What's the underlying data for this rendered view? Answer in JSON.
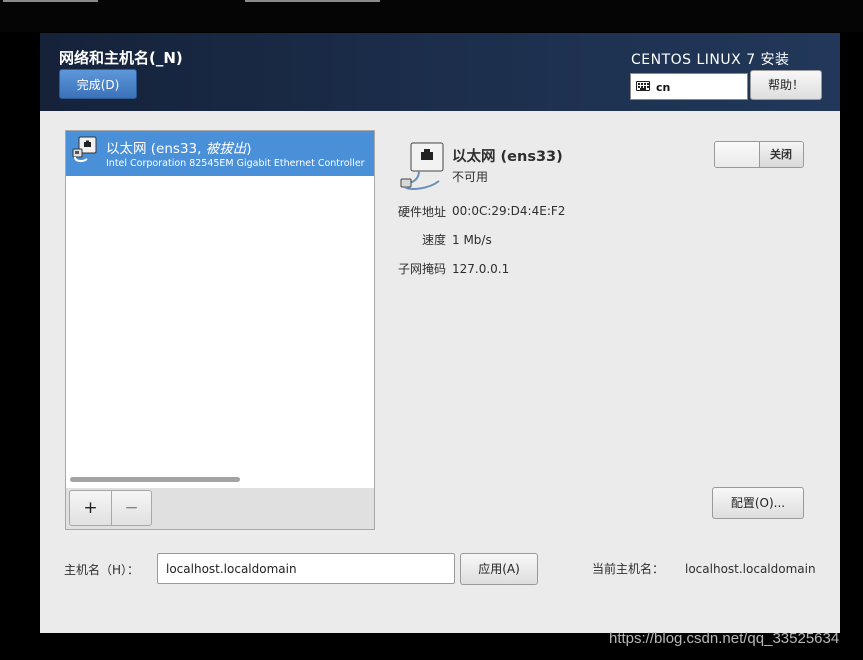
{
  "window": {
    "title": "网络和主机名(_N)",
    "done_label": "完成(D)",
    "product_title": "CENTOS LINUX 7 安装",
    "keyboard_layout": "cn",
    "help_label": "帮助！"
  },
  "device_list": {
    "items": [
      {
        "name": "以太网 (ens33, ",
        "name_state": "被拔出",
        "name_close": ")",
        "description": "Intel Corporation 82545EM Gigabit Ethernet Controller",
        "selected": true
      }
    ],
    "add_label": "+",
    "remove_label": "−"
  },
  "device_detail": {
    "name": "以太网 (ens33)",
    "status": "不可用",
    "toggle_label": "关闭",
    "properties": [
      {
        "label": "硬件地址",
        "value": "00:0C:29:D4:4E:F2"
      },
      {
        "label": "速度",
        "value": "1 Mb/s"
      },
      {
        "label": "子网掩码",
        "value": "127.0.0.1"
      }
    ],
    "configure_label": "配置(O)..."
  },
  "hostname": {
    "label": "主机名（H）：",
    "value": "localhost.localdomain",
    "apply_label": "应用(A)",
    "current_label": "当前主机名：",
    "current_value": "localhost.localdomain"
  },
  "watermark": "https://blog.csdn.net/qq_33525634",
  "colors": {
    "header_bg": "#1c2f4d",
    "accent_blue": "#4a90d9",
    "window_bg": "#ebebeb"
  }
}
